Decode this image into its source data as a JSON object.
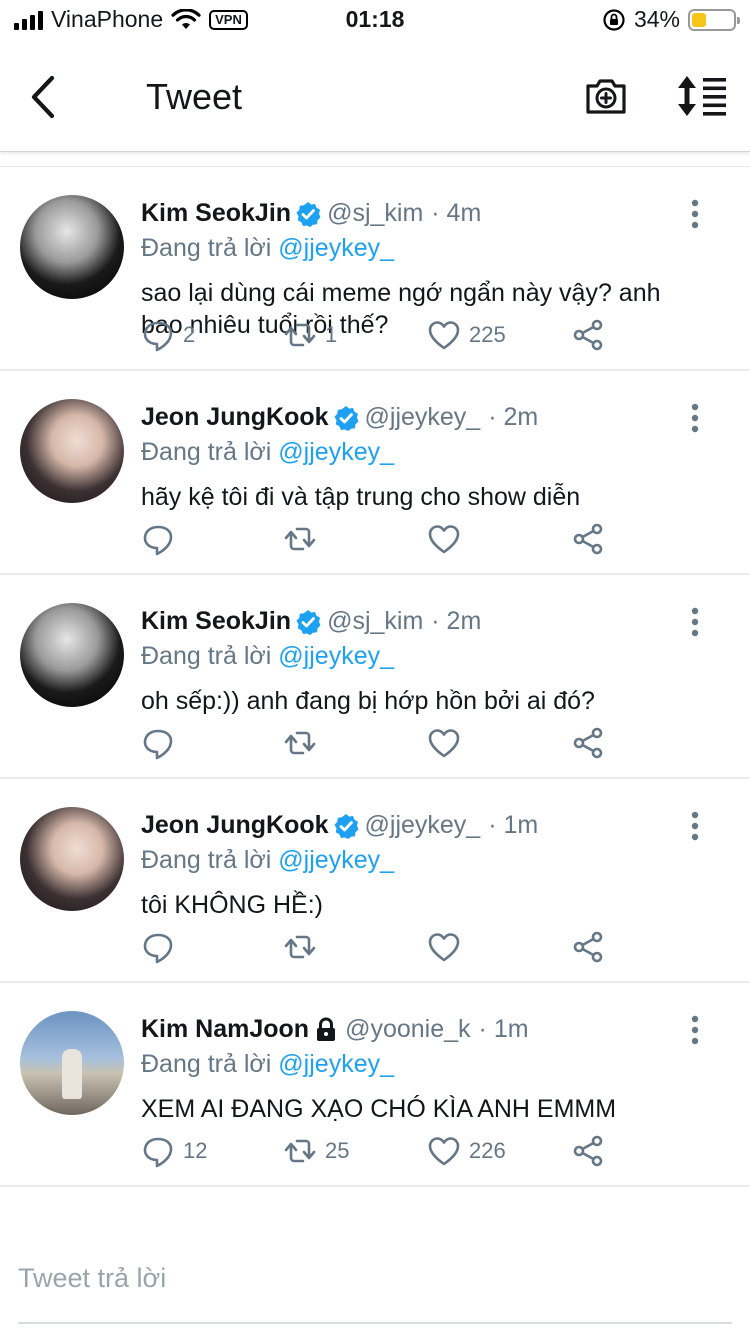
{
  "status_bar": {
    "carrier": "VinaPhone",
    "vpn": "VPN",
    "time": "01:18",
    "battery": "34%",
    "battery_level": 0.34,
    "battery_color": "#f5c518"
  },
  "nav": {
    "title": "Tweet",
    "back_icon": "chevron-left-icon",
    "camera_icon": "camera-plus-icon",
    "sort_icon": "sort-list-icon"
  },
  "colors": {
    "accent": "#1da1f2",
    "muted_text": "#657786",
    "primary_text": "#14171a"
  },
  "tweets": [
    {
      "name": "Kim SeokJin",
      "badge": "verified",
      "handle": "@sj_kim",
      "time": "· 4m",
      "reply_prefix": "Đang trả lời",
      "reply_to": "@jjeykey_",
      "text": "sao lại dùng cái meme ngớ ngẩn này vậy? anh bao nhiêu tuổi rồi thế?",
      "replies": "2",
      "retweets": "1",
      "likes": "225"
    },
    {
      "name": "Jeon JungKook",
      "badge": "verified",
      "handle": "@jjeykey_",
      "time": "· 2m",
      "reply_prefix": "Đang trả lời",
      "reply_to": "@jjeykey_",
      "text": "hãy kệ tôi đi và tập trung cho show diễn",
      "replies": "",
      "retweets": "",
      "likes": ""
    },
    {
      "name": "Kim SeokJin",
      "badge": "verified",
      "handle": "@sj_kim",
      "time": "· 2m",
      "reply_prefix": "Đang trả lời",
      "reply_to": "@jjeykey_",
      "text": "oh sếp:)) anh đang bị hớp hồn bởi ai đó?",
      "replies": "",
      "retweets": "",
      "likes": ""
    },
    {
      "name": "Jeon JungKook",
      "badge": "verified",
      "handle": "@jjeykey_",
      "time": "· 1m",
      "reply_prefix": "Đang trả lời",
      "reply_to": "@jjeykey_",
      "text": "tôi KHÔNG HỀ:)",
      "replies": "",
      "retweets": "",
      "likes": ""
    },
    {
      "name": "Kim NamJoon",
      "badge": "lock",
      "handle": "@yoonie_k",
      "time": "· 1m",
      "reply_prefix": "Đang trả lời",
      "reply_to": "@jjeykey_",
      "text": "XEM AI ĐANG XẠO CHÓ KÌA ANH EMMM",
      "replies": "12",
      "retweets": "25",
      "likes": "226"
    }
  ],
  "composer": {
    "placeholder": "Tweet trả lời"
  }
}
